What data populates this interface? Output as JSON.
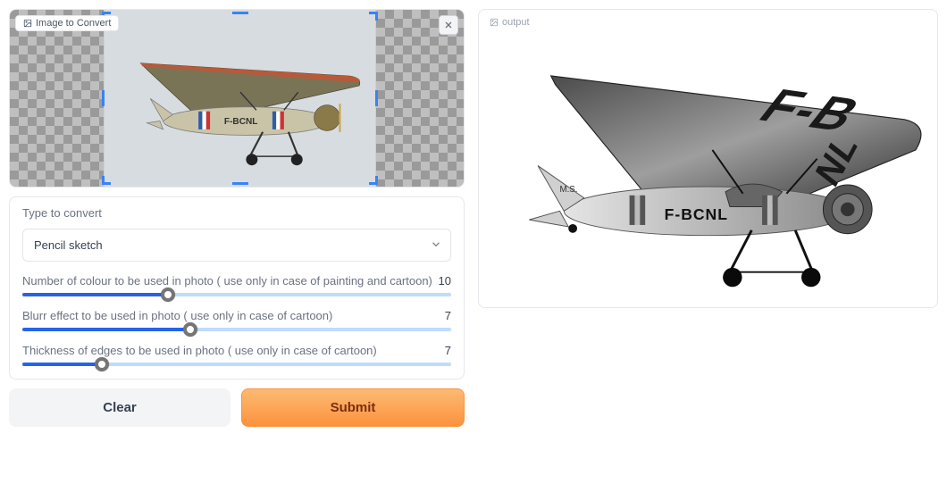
{
  "input": {
    "label": "Image to Convert",
    "plane_registration": "F-BCNL"
  },
  "controls": {
    "type_label": "Type to convert",
    "type_value": "Pencil sketch",
    "sliders": [
      {
        "label": "Number of colour to be used in photo ( use only in case of painting and cartoon)",
        "value": 10,
        "min": 0,
        "max": 30,
        "pct": 33
      },
      {
        "label": "Blurr effect to be used in photo ( use only in case of cartoon)",
        "value": 7,
        "min": 0,
        "max": 18,
        "pct": 39
      },
      {
        "label": "Thickness of edges to be used in photo ( use only in case of cartoon)",
        "value": 7,
        "min": 0,
        "max": 40,
        "pct": 18
      }
    ]
  },
  "buttons": {
    "clear": "Clear",
    "submit": "Submit"
  },
  "output": {
    "label": "output",
    "plane_registration": "F-BCNL"
  },
  "colors": {
    "track_fill": "#2563eb",
    "track_empty": "#bfdbfe",
    "accent_orange": "#fb923c"
  }
}
